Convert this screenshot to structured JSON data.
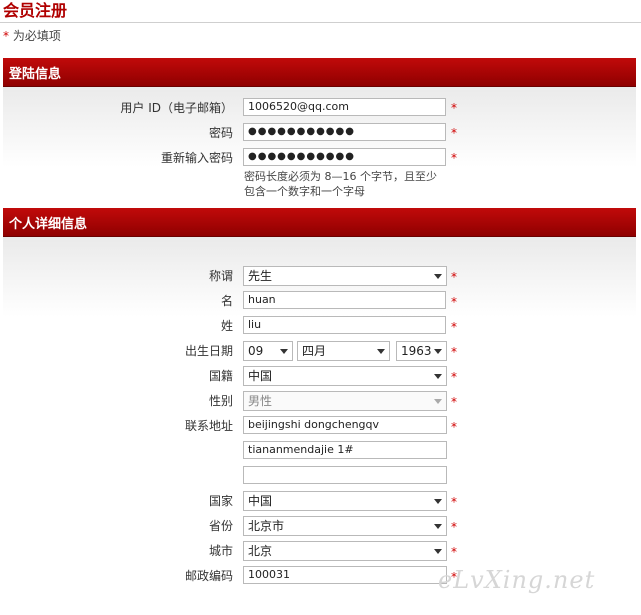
{
  "page": {
    "title": "会员注册",
    "required_note": "为必填项",
    "required_mark": "*"
  },
  "login_section": {
    "title": "登陆信息",
    "user_id_label": "用户 ID（电子邮箱）",
    "user_id_value": "1006520@qq.com",
    "password_label": "密码",
    "password_value": "●●●●●●●●●●●",
    "confirm_label": "重新输入密码",
    "confirm_value": "●●●●●●●●●●●",
    "hint_line1": "密码长度必须为 8—16 个字节，且至少",
    "hint_line2": "包含一个数字和一个字母"
  },
  "personal_section": {
    "title": "个人详细信息",
    "salutation_label": "称谓",
    "salutation_value": "先生",
    "first_name_label": "名",
    "first_name_value": "huan",
    "last_name_label": "姓",
    "last_name_value": "liu",
    "birthdate_label": "出生日期",
    "birth_day": "09",
    "birth_month": "四月",
    "birth_year": "1963",
    "nationality_label": "国籍",
    "nationality_value": "中国",
    "gender_label": "性别",
    "gender_value": "男性",
    "address_label": "联系地址",
    "address_line1": "beijingshi dongchengqv",
    "address_line2": "tiananmendajie 1#",
    "address_line3": "",
    "country_label": "国家",
    "country_value": "中国",
    "province_label": "省份",
    "province_value": "北京市",
    "city_label": "城市",
    "city_value": "北京",
    "postcode_label": "邮政编码",
    "postcode_value": "100031"
  },
  "watermark": "eLvXing.net",
  "colors": {
    "brand_red": "#b00000",
    "required_red": "#d00000"
  }
}
